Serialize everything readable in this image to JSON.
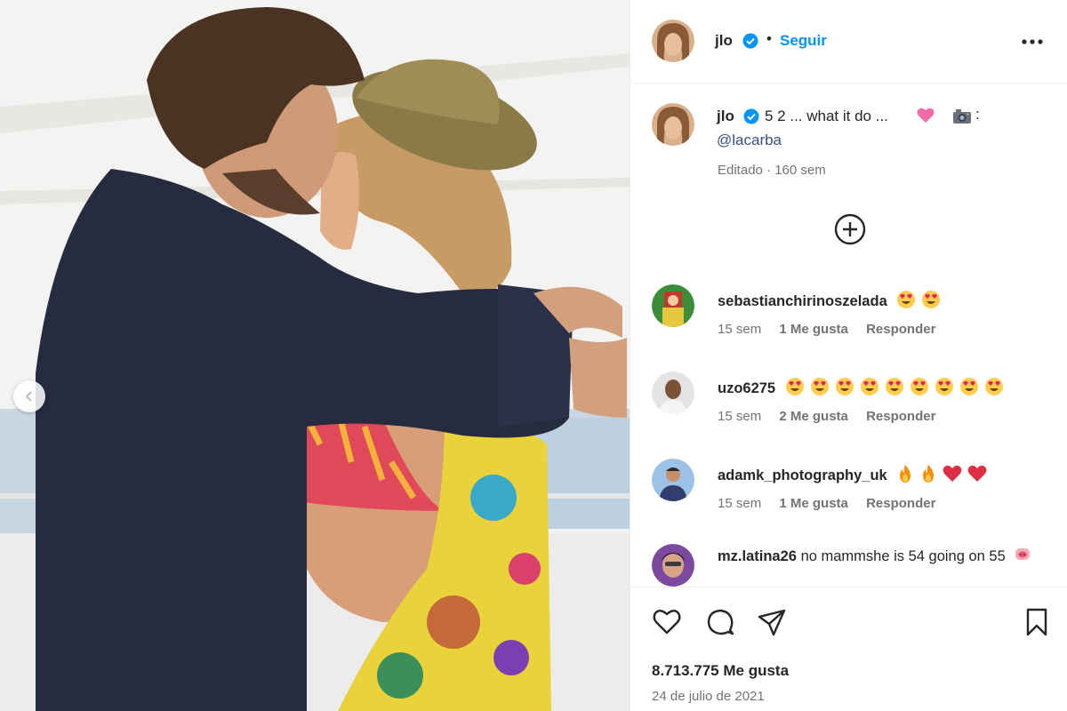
{
  "header": {
    "username": "jlo",
    "dot": "•",
    "follow_label": "Seguir"
  },
  "caption": {
    "username": "jlo",
    "text": "5 2 ... what it do ...",
    "colon": ":",
    "mention": "@lacarba",
    "meta": "Editado · 160 sem"
  },
  "comments": [
    {
      "username": "sebastianchirinoszelada",
      "text": "",
      "emojis": [
        "heart-eyes",
        "heart-eyes"
      ],
      "time": "15 sem",
      "likes": "1 Me gusta",
      "reply": "Responder"
    },
    {
      "username": "uzo6275",
      "text": "",
      "emojis": [
        "heart-eyes",
        "heart-eyes",
        "heart-eyes",
        "heart-eyes",
        "heart-eyes",
        "heart-eyes",
        "heart-eyes",
        "heart-eyes",
        "heart-eyes"
      ],
      "time": "15 sem",
      "likes": "2 Me gusta",
      "reply": "Responder"
    },
    {
      "username": "adamk_photography_uk",
      "text": "",
      "emojis": [
        "fire",
        "fire",
        "red-heart",
        "red-heart"
      ],
      "time": "15 sem",
      "likes": "1 Me gusta",
      "reply": "Responder"
    },
    {
      "username": "mz.latina26",
      "text": "no mammshe is 54 going on 55",
      "emojis": [
        "pig-face"
      ]
    }
  ],
  "actions": {
    "likes": "8.713.775 Me gusta",
    "date": "24 de julio de 2021"
  },
  "colors": {
    "accent": "#0095f6",
    "mention": "#385185",
    "secondary_text": "#737373",
    "verified": "#0095f6"
  },
  "icons": [
    "chevron-left-icon",
    "verified-badge-icon",
    "more-options-icon",
    "add-circle-icon",
    "heart-icon",
    "comment-icon",
    "share-icon",
    "bookmark-icon"
  ]
}
